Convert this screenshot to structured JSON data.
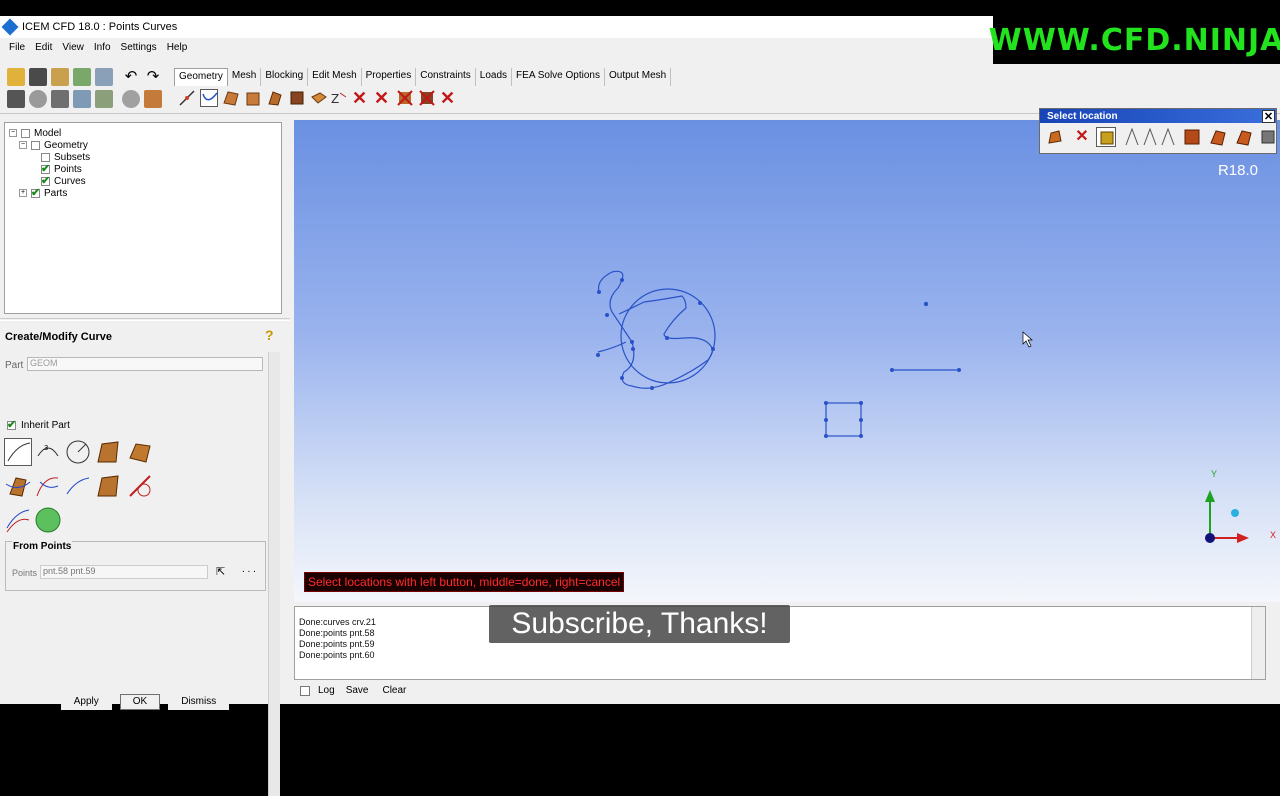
{
  "window": {
    "title": "ICEM CFD 18.0 : Points Curves"
  },
  "menu": [
    "File",
    "Edit",
    "View",
    "Info",
    "Settings",
    "Help"
  ],
  "brand": "WWW.CFD.NINJA",
  "tabs": [
    "Geometry",
    "Mesh",
    "Blocking",
    "Edit Mesh",
    "Properties",
    "Constraints",
    "Loads",
    "FEA Solve Options",
    "Output Mesh"
  ],
  "tree": {
    "model": "Model",
    "geometry": "Geometry",
    "subsets": "Subsets",
    "points": "Points",
    "curves": "Curves",
    "parts": "Parts"
  },
  "panel": {
    "title": "Create/Modify Curve",
    "part_label": "Part",
    "part_value": "GEOM",
    "inherit_label": "Inherit Part",
    "from_points_title": "From Points",
    "points_label": "Points",
    "points_value": "pnt.58 pnt.59",
    "more": ". . ."
  },
  "buttons": {
    "apply": "Apply",
    "ok": "OK",
    "dismiss": "Dismiss"
  },
  "viewport": {
    "version": "R18.0",
    "prompt": "Select locations with left button, middle=done, right=cancel",
    "axis_y": "Y",
    "axis_x": "X"
  },
  "select_location": {
    "title": "Select location"
  },
  "messages": [
    "Done:curves crv.21",
    "Done:points pnt.58",
    "Done:points pnt.59",
    "Done:points pnt.60"
  ],
  "subtitle": "Subscribe, Thanks!",
  "log": {
    "log_label": "Log",
    "save": "Save",
    "clear": "Clear"
  }
}
